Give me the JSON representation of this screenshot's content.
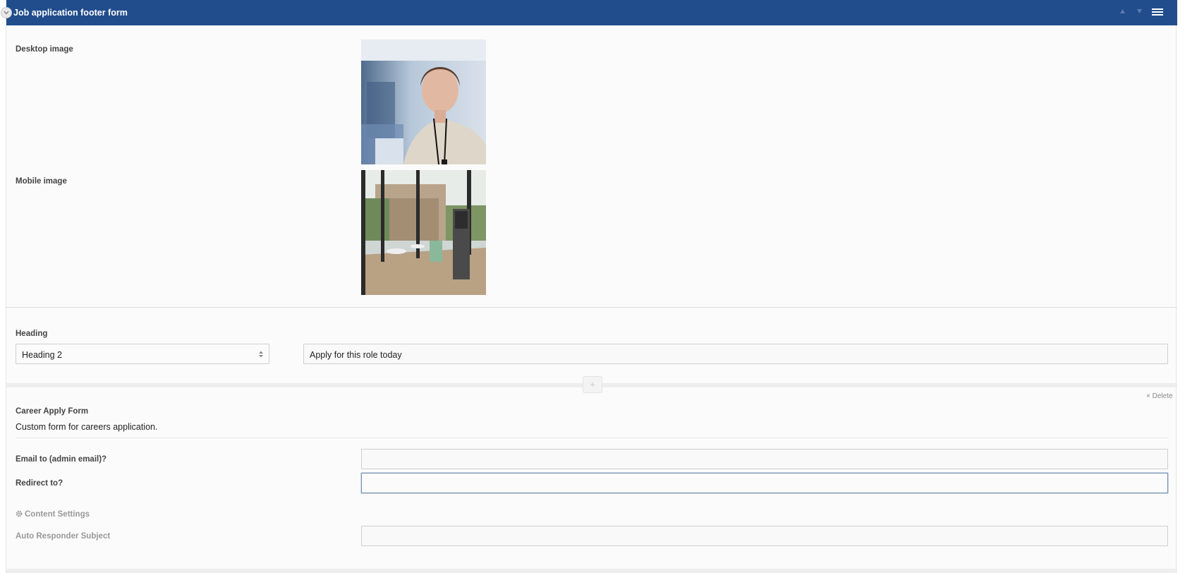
{
  "window": {
    "title": "Job application footer form"
  },
  "images": {
    "desktop_label": "Desktop image",
    "mobile_label": "Mobile image"
  },
  "heading": {
    "label": "Heading",
    "level_selected": "Heading 2",
    "text_value": "Apply for this role today"
  },
  "form_block": {
    "delete_label": "× Delete",
    "title": "Career Apply Form",
    "description": "Custom form for careers application.",
    "email_label": "Email to (admin email)?",
    "email_value": "",
    "redirect_label": "Redirect to?",
    "redirect_value": "",
    "content_settings_label": "Content Settings",
    "auto_responder_label": "Auto Responder Subject",
    "auto_responder_value": ""
  },
  "icons": {
    "collapse": "chevron-down-icon",
    "move_up": "triangle-up-icon",
    "move_down": "triangle-down-icon",
    "menu": "hamburger-menu-icon",
    "add": "plus-icon",
    "settings": "gear-icon"
  },
  "colors": {
    "header_bg": "#214d8d",
    "panel_bg": "#fbfbfb",
    "focus_border": "#6f8fb2"
  }
}
